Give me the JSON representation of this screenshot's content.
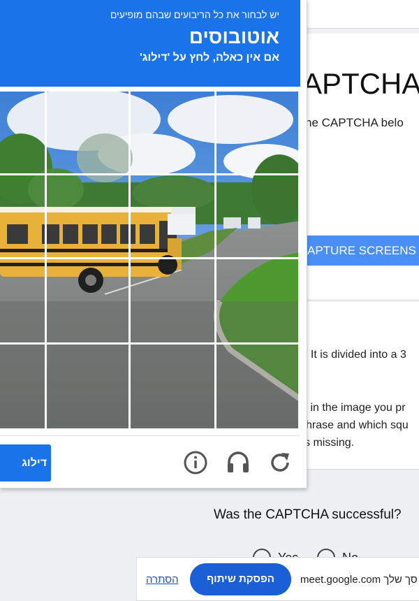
{
  "background_page": {
    "title": "APTCHA",
    "instruction": "he CAPTCHA belo",
    "capture_button": "APTURE SCREENS",
    "description_lines": [
      ". It is divided into a 3",
      "it in the image you pr",
      "hrase and which squ",
      "s missing."
    ],
    "question": "Was the CAPTCHA successful?",
    "yes_label": "Yes",
    "no_label": "No"
  },
  "captcha": {
    "header_small": "יש לבחור את כל הריבועים שבהם מופיעים",
    "header_target": "אוטובוסים",
    "header_sub": "אם אין כאלה, לחץ על 'דילוג'",
    "accent": "#1a73e8",
    "grid": {
      "columns": 4,
      "rows": 4
    },
    "verify_button": "דילוג",
    "icons": [
      "info-icon",
      "headphones-icon",
      "reload-icon"
    ]
  },
  "share_bar": {
    "hide_link": "הסתרה",
    "stop_button": "הפסקת שיתוף",
    "share_text": "meet.google.com סך שלך"
  }
}
